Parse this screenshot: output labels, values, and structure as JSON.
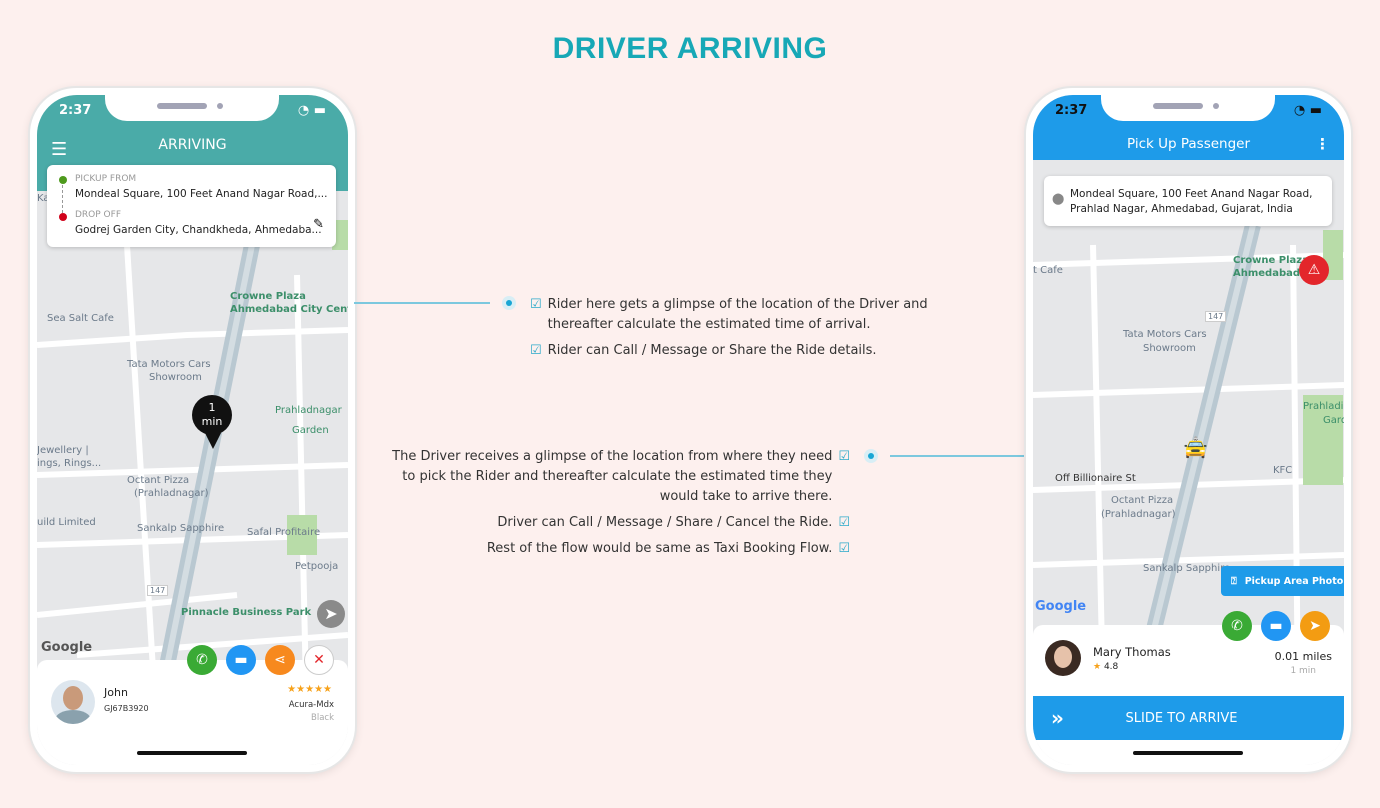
{
  "page_title": "DRIVER ARRIVING",
  "rider_app": {
    "time": "2:37",
    "header_title": "ARRIVING",
    "pickup_label": "PICKUP FROM",
    "pickup_address": "Mondeal Square, 100 Feet Anand Nagar Road,...",
    "drop_label": "DROP OFF",
    "drop_address": "Godrej Garden City, Chandkheda, Ahmedaba...",
    "eta_bubble": [
      "1",
      "min"
    ],
    "map_labels": [
      "Crowne Plaza",
      "Ahmedabad City Centre",
      "Sea Salt Cafe",
      "Tata Motors Cars",
      "Showroom",
      "Prahladnagar",
      "Garden",
      "Octant Pizza",
      "(Prahladnagar)",
      "Sankalp Sapphire",
      "Safal Profitaire",
      "Petpooja",
      "Pinnacle Business Park",
      "147",
      "Jewellery |",
      "ings, Rings...",
      "uild Limited",
      "Ka"
    ],
    "driver": {
      "name": "John",
      "plate": "GJ67B3920",
      "rating": 5,
      "stars": "★★★★★",
      "car": "Acura-Mdx",
      "color": "Black"
    },
    "actions": [
      "call",
      "message",
      "share",
      "cancel"
    ],
    "accent": "#4aaba8"
  },
  "driver_app": {
    "time": "2:37",
    "header_title": "Pick Up Passenger",
    "address": "Mondeal Square, 100 Feet Anand Nagar Road, Prahlad Nagar, Ahmedabad, Gujarat, India",
    "map_labels": [
      "Crowne Plaza",
      "Ahmedabad C",
      "t Cafe",
      "Tata Motors Cars",
      "Showroom",
      "147",
      "Prahladi",
      "Gard",
      "Off Billionaire St",
      "KFC",
      "Octant Pizza",
      "(Prahladnagar)",
      "Sankalp Sapphire"
    ],
    "pickup_photo_label": "Pickup Area Photo",
    "passenger": {
      "name": "Mary Thomas",
      "rating": "4.8",
      "distance": "0.01 miles",
      "eta": "1 min"
    },
    "slide_label": "SLIDE TO ARRIVE",
    "accent": "#1e9be9"
  },
  "rider_notes": [
    "Rider here gets a glimpse of the location of the Driver and thereafter calculate the estimated time of arrival.",
    "Rider can Call / Message or Share the Ride details."
  ],
  "driver_notes": [
    "The Driver receives a glimpse of the location from where they need to pick the Rider and thereafter calculate the estimated time they would take to arrive there.",
    "Driver can Call / Message / Share / Cancel the Ride.",
    "Rest of the flow would be same as Taxi Booking Flow."
  ],
  "google_label": "Google"
}
